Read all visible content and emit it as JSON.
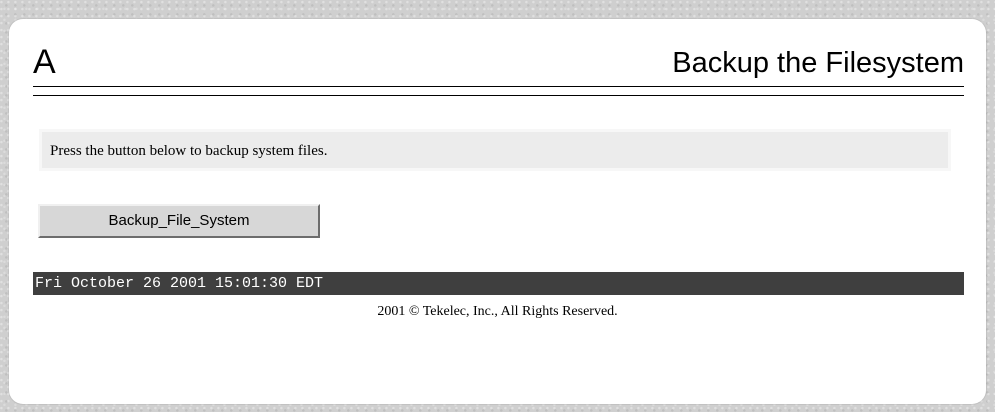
{
  "header": {
    "logo_text": "A",
    "title": "Backup the Filesystem"
  },
  "message": {
    "text": "Press the button below to backup system files."
  },
  "actions": {
    "backup_button_label": "Backup_File_System"
  },
  "status": {
    "datetime": "Fri October 26 2001 15:01:30 EDT"
  },
  "footer": {
    "copyright": "2001 © Tekelec, Inc., All Rights Reserved."
  },
  "colors": {
    "background": "#cfcfcf",
    "panel": "#ffffff",
    "message_box": "#ececec",
    "status_bar": "#3f3f3f",
    "status_text": "#ffffff"
  }
}
